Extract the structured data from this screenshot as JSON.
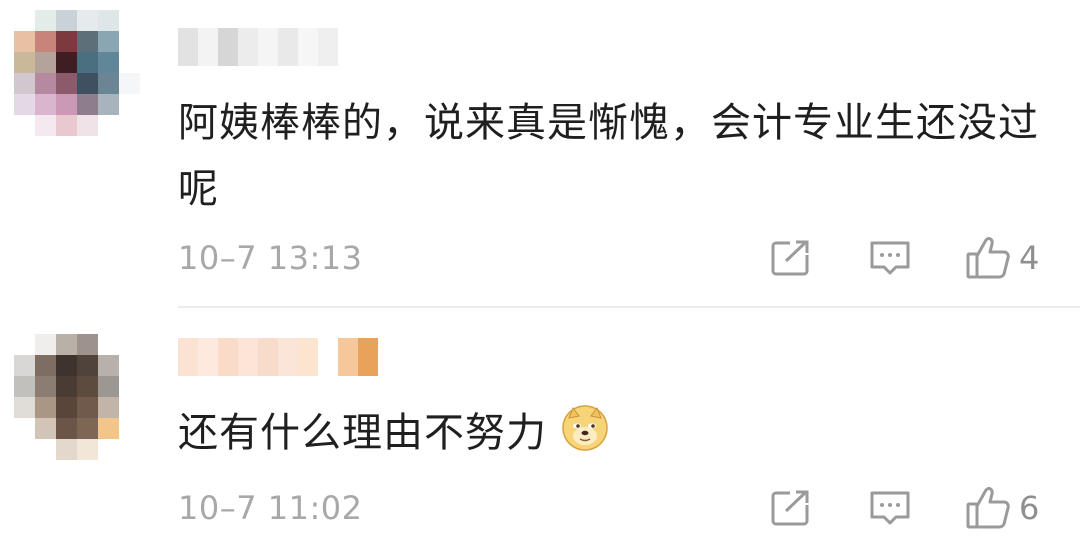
{
  "comments": [
    {
      "text": "阿姨棒棒的，说来真是惭愧，会计专业生还没过呢",
      "time": "10–7 13:13",
      "likes": "4",
      "avatar_pixels": [
        [
          "#ffffff",
          "#e3ece9",
          "#c9d2d6",
          "#e6eaec",
          "#dfe6e8",
          "#ffffff"
        ],
        [
          "#e8c0a4",
          "#c8847a",
          "#7d3a3e",
          "#5d6f78",
          "#8aa6b3",
          "#ffffff"
        ],
        [
          "#c9b89a",
          "#b4a39b",
          "#3e1e22",
          "#4a6f80",
          "#5f8799",
          "#ffffff"
        ],
        [
          "#d3c7cf",
          "#b58aa1",
          "#8b5a6b",
          "#3f5160",
          "#6b8595",
          "#f4f6f8"
        ],
        [
          "#e5d8e6",
          "#d9b6ce",
          "#cb98b5",
          "#8e7d8c",
          "#a7b4bd",
          "#ffffff"
        ],
        [
          "#ffffff",
          "#f4e9ef",
          "#e9c8cf",
          "#efe3e8",
          "#ffffff",
          "#ffffff"
        ]
      ],
      "name_blocks": [
        "#e2e2e2",
        "#f3f3f3",
        "#d6d6d6",
        "#ececec",
        "#f5f5f5",
        "#e9e9e9",
        "#f6f6f6",
        "#efefef"
      ]
    },
    {
      "text": "还有什么理由不努力",
      "time": "10–7 11:02",
      "likes": "6",
      "emoji": "doge-emoji",
      "avatar_pixels": [
        [
          "#ffffff",
          "#efeeec",
          "#b9b0a8",
          "#9d928c",
          "#ffffff",
          "#ffffff"
        ],
        [
          "#d9d7d5",
          "#7d6d63",
          "#3f332d",
          "#4f433c",
          "#b7b0ab",
          "#ffffff"
        ],
        [
          "#c2c0bd",
          "#8b7d72",
          "#4b3c33",
          "#5d4b40",
          "#9c9793",
          "#ffffff"
        ],
        [
          "#e0dcd8",
          "#a99684",
          "#5a453a",
          "#6f5a4c",
          "#c2b4a6",
          "#ffffff"
        ],
        [
          "#ffffff",
          "#d2c4b6",
          "#6b5547",
          "#7e6654",
          "#f3c58a",
          "#ffffff"
        ],
        [
          "#ffffff",
          "#ffffff",
          "#e4d8cc",
          "#f2e6d8",
          "#ffffff",
          "#ffffff"
        ]
      ],
      "name_blocks": [
        "#fbe3d4",
        "#fde9dd",
        "#f9dbc8",
        "#fce4d6",
        "#f8dccb",
        "#fbe5d8",
        "#fde4cf",
        "#ffffff",
        "#f6c79a",
        "#e8a35b"
      ]
    }
  ],
  "colors": {
    "meta_gray": "#a8a8a8",
    "icon_gray": "#9a9a9a",
    "divider": "#ececec"
  },
  "icons": {
    "share": "share-icon",
    "reply": "comment-icon",
    "like": "thumbs-up-icon"
  }
}
